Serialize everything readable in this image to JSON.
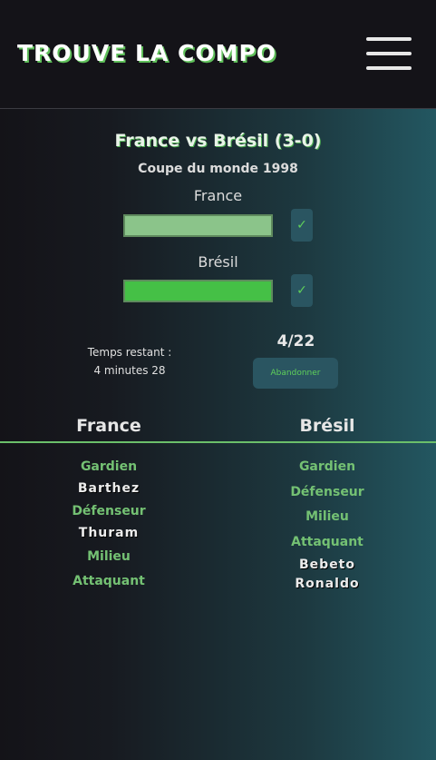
{
  "header": {
    "logo": "TROUVE LA COMPO",
    "menu_icon": "hamburger-menu-icon"
  },
  "match": {
    "title": "France vs Brésil (3-0)",
    "competition": "Coupe du monde 1998"
  },
  "guesses": [
    {
      "team": "France",
      "input_value": "",
      "input_color": "#8bc48a",
      "check_icon": "check-icon"
    },
    {
      "team": "Brésil",
      "input_value": "",
      "input_color": "#45c046",
      "check_icon": "check-icon"
    }
  ],
  "status": {
    "timer_label": "Temps restant :",
    "timer_value": "4 minutes 28",
    "score": "4/22",
    "abandon_label": "Abandonner"
  },
  "columns": {
    "france": {
      "title": "France",
      "items": [
        {
          "kind": "pos",
          "text": "Gardien"
        },
        {
          "kind": "player",
          "text": "Barthez"
        },
        {
          "kind": "pos",
          "text": "Défenseur"
        },
        {
          "kind": "player",
          "text": "Thuram"
        },
        {
          "kind": "pos",
          "text": "Milieu"
        },
        {
          "kind": "pos",
          "text": "Attaquant"
        }
      ]
    },
    "bresil": {
      "title": "Brésil",
      "items": [
        {
          "kind": "pos",
          "text": "Gardien"
        },
        {
          "kind": "pos",
          "text": "Défenseur"
        },
        {
          "kind": "pos",
          "text": "Milieu"
        },
        {
          "kind": "pos",
          "text": "Attaquant"
        },
        {
          "kind": "player",
          "text": "Bebeto"
        },
        {
          "kind": "player",
          "text": "Ronaldo"
        }
      ]
    }
  }
}
